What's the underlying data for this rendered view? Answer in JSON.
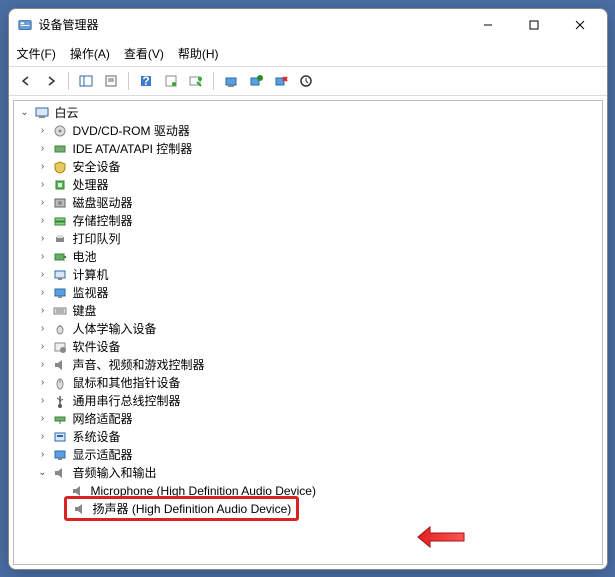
{
  "window": {
    "title": "设备管理器"
  },
  "menubar": {
    "file": "文件(F)",
    "action": "操作(A)",
    "view": "查看(V)",
    "help": "帮助(H)"
  },
  "tree": {
    "root": {
      "label": "白云",
      "expanded": true
    },
    "categories": [
      {
        "label": "DVD/CD-ROM 驱动器",
        "icon": "disc"
      },
      {
        "label": "IDE ATA/ATAPI 控制器",
        "icon": "ide"
      },
      {
        "label": "安全设备",
        "icon": "security"
      },
      {
        "label": "处理器",
        "icon": "cpu"
      },
      {
        "label": "磁盘驱动器",
        "icon": "disk"
      },
      {
        "label": "存储控制器",
        "icon": "storage"
      },
      {
        "label": "打印队列",
        "icon": "printer"
      },
      {
        "label": "电池",
        "icon": "battery"
      },
      {
        "label": "计算机",
        "icon": "computer"
      },
      {
        "label": "监视器",
        "icon": "monitor"
      },
      {
        "label": "键盘",
        "icon": "keyboard"
      },
      {
        "label": "人体学输入设备",
        "icon": "hid"
      },
      {
        "label": "软件设备",
        "icon": "software"
      },
      {
        "label": "声音、视频和游戏控制器",
        "icon": "sound"
      },
      {
        "label": "鼠标和其他指针设备",
        "icon": "mouse"
      },
      {
        "label": "通用串行总线控制器",
        "icon": "usb"
      },
      {
        "label": "网络适配器",
        "icon": "network"
      },
      {
        "label": "系统设备",
        "icon": "system"
      },
      {
        "label": "显示适配器",
        "icon": "display"
      }
    ],
    "audioCategory": {
      "label": "音频输入和输出",
      "expanded": true
    },
    "audioItems": [
      {
        "label": "Microphone (High Definition Audio Device)"
      },
      {
        "label": "扬声器 (High Definition Audio Device)"
      }
    ]
  }
}
